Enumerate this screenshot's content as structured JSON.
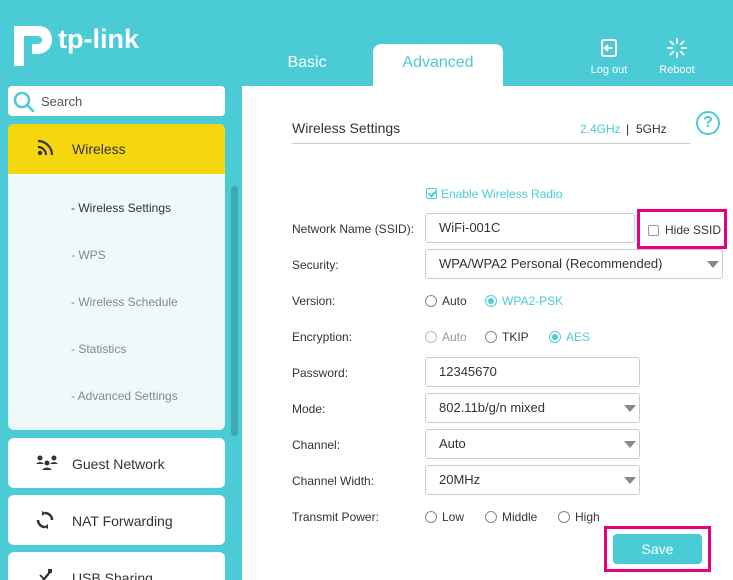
{
  "brand": {
    "logo_text": "tp-link"
  },
  "header": {
    "tabs": [
      {
        "label": "Basic",
        "active": false
      },
      {
        "label": "Advanced",
        "active": true
      }
    ],
    "logout_label": "Log out",
    "reboot_label": "Reboot"
  },
  "sidebar": {
    "search_placeholder": "Search",
    "wireless": {
      "label": "Wireless",
      "sub_items": [
        {
          "label": "- Wireless Settings",
          "active": true
        },
        {
          "label": "- WPS",
          "active": false
        },
        {
          "label": "- Wireless Schedule",
          "active": false
        },
        {
          "label": "- Statistics",
          "active": false
        },
        {
          "label": "- Advanced Settings",
          "active": false
        }
      ]
    },
    "items": [
      {
        "label": "Guest Network",
        "icon": "guest-network-icon"
      },
      {
        "label": "NAT Forwarding",
        "icon": "nat-forwarding-icon"
      },
      {
        "label": "USB Sharing",
        "icon": "usb-icon"
      }
    ]
  },
  "main": {
    "title": "Wireless Settings",
    "bands": {
      "b24": "2.4GHz",
      "sep": "|",
      "b5": "5GHz",
      "active": "2.4GHz"
    },
    "help_label": "?",
    "enable_radio": {
      "label": "Enable Wireless Radio",
      "checked": true
    },
    "ssid": {
      "label": "Network Name (SSID):",
      "value": "WiFi-001C"
    },
    "hide_ssid": {
      "label": "Hide SSID",
      "checked": false
    },
    "security": {
      "label": "Security:",
      "value": "WPA/WPA2 Personal (Recommended)"
    },
    "version": {
      "label": "Version:",
      "options": [
        "Auto",
        "WPA2-PSK"
      ],
      "selected": "WPA2-PSK"
    },
    "encryption": {
      "label": "Encryption:",
      "options": [
        "Auto",
        "TKIP",
        "AES"
      ],
      "selected": "AES"
    },
    "password": {
      "label": "Password:",
      "value": "12345670"
    },
    "mode": {
      "label": "Mode:",
      "value": "802.11b/g/n mixed"
    },
    "channel": {
      "label": "Channel:",
      "value": "Auto"
    },
    "channel_width": {
      "label": "Channel Width:",
      "value": "20MHz"
    },
    "transmit_power": {
      "label": "Transmit Power:",
      "options": [
        "Low",
        "Middle",
        "High"
      ],
      "selected": ""
    },
    "save_label": "Save"
  },
  "colors": {
    "accent": "#4acbd6",
    "highlight": "#f5d70f",
    "annotation": "#e6007e"
  }
}
